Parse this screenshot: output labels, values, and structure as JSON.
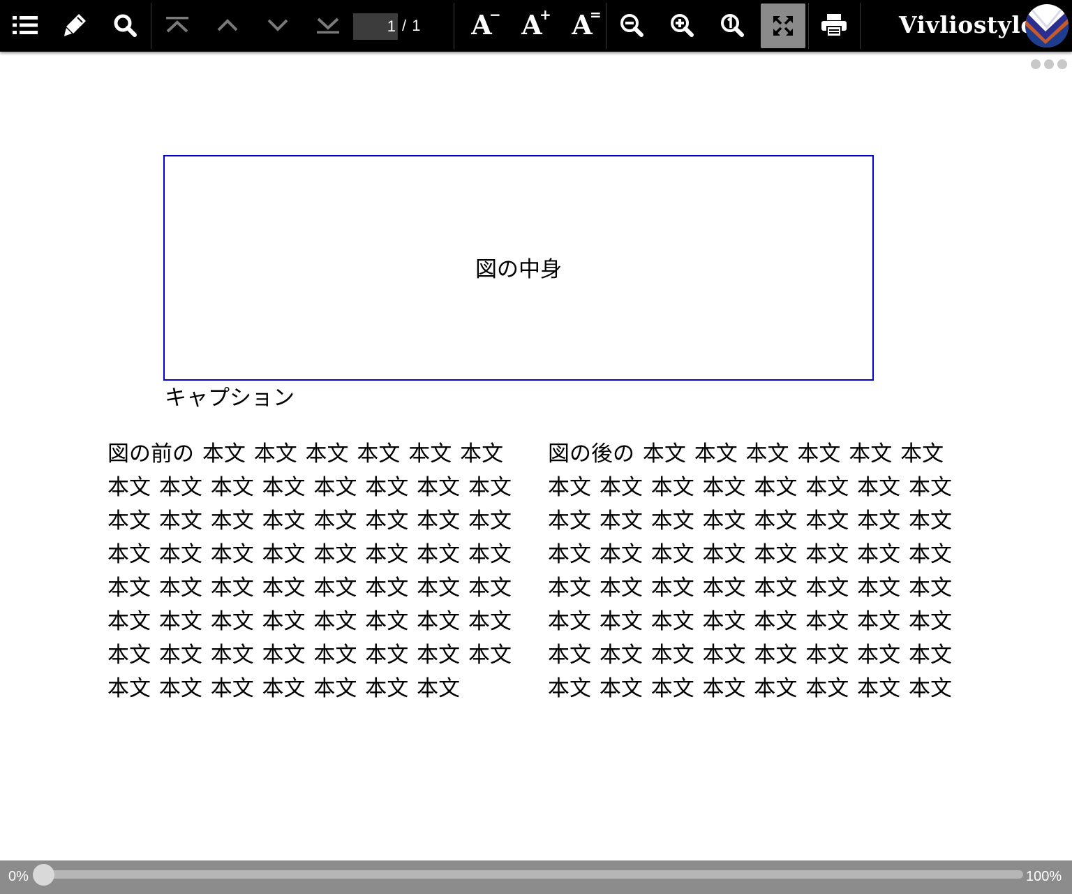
{
  "toolbar": {
    "icons": [
      "list-icon",
      "highlighter-pen-icon",
      "search-icon",
      "first-page-icon",
      "previous-page-icon",
      "next-page-icon",
      "last-page-icon",
      "font-decrease-icon",
      "font-increase-icon",
      "font-reset-icon",
      "zoom-out-icon",
      "zoom-in-icon",
      "zoom-actual-size-icon",
      "fit-to-screen-icon",
      "print-icon"
    ],
    "font_decrease_label": "A",
    "font_decrease_sign": "−",
    "font_increase_label": "A",
    "font_increase_sign": "+",
    "font_reset_label": "A",
    "font_reset_sign": "=",
    "page_input_value": "1",
    "page_total": "/ 1",
    "brand": "Vivliostyle",
    "active_tool": "fit-to-screen"
  },
  "document": {
    "figure_content": "図の中身",
    "caption": "キャプション",
    "column_left": "図の前の 本文 本文 本文 本文 本文 本文 本文 本文 本文 本文 本文 本文 本文 本文 本文 本文 本文 本文 本文 本文 本文 本文 本文 本文 本文 本文 本文 本文 本文 本文 本文 本文 本文 本文 本文 本文 本文 本文 本文 本文 本文 本文 本文 本文 本文 本文 本文 本文 本文 本文 本文 本文 本文 本文 本文 本文 本文 本文 本文 本文 本文",
    "column_right": "図の後の 本文 本文 本文 本文 本文 本文 本文 本文 本文 本文 本文 本文 本文 本文 本文 本文 本文 本文 本文 本文 本文 本文 本文 本文 本文 本文 本文 本文 本文 本文 本文 本文 本文 本文 本文 本文 本文 本文 本文 本文 本文 本文 本文 本文 本文 本文 本文 本文 本文 本文 本文 本文 本文 本文 本文 本文 本文 本文 本文 本文 本文 本文",
    "figure_border_color": "#0000cc"
  },
  "progress": {
    "start_label": "0%",
    "end_label": "100%",
    "value_percent": 0
  },
  "colors": {
    "toolbar_bg": "#000000",
    "active_button_bg": "#8a8a8a",
    "progress_bg": "#8c8c8c"
  }
}
